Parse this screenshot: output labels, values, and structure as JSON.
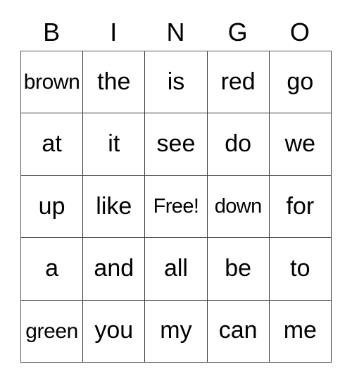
{
  "card": {
    "header": {
      "letters": [
        "B",
        "I",
        "N",
        "G",
        "O"
      ]
    },
    "grid": {
      "rows": [
        [
          "brown",
          "the",
          "is",
          "red",
          "go"
        ],
        [
          "at",
          "it",
          "see",
          "do",
          "we"
        ],
        [
          "up",
          "like",
          "Free!",
          "down",
          "for"
        ],
        [
          "a",
          "and",
          "all",
          "be",
          "to"
        ],
        [
          "green",
          "you",
          "my",
          "can",
          "me"
        ]
      ]
    },
    "free_space": {
      "label": "Free!",
      "row": 3,
      "column": 3
    },
    "colors": {
      "background": "#ffffff",
      "text": "#000000",
      "grid_line": "#3a3a3a",
      "outer_line": "#5a5a5a"
    }
  }
}
